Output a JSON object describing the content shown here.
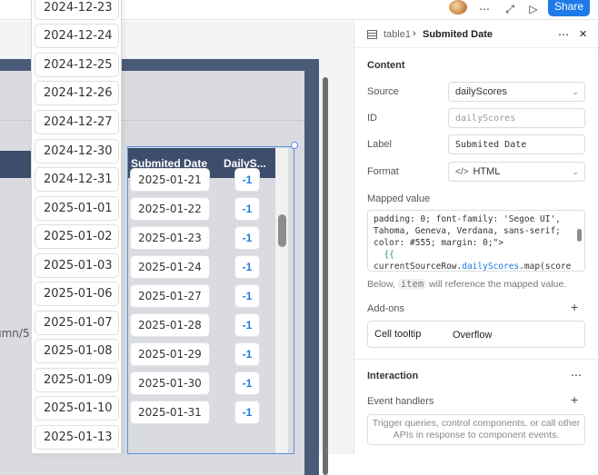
{
  "topbar": {
    "more_icon": "⋯",
    "expand_icon": "⤢",
    "play_icon": "▷",
    "share_label": "Share"
  },
  "canvas": {
    "side_text": "umn/5"
  },
  "dropdown": {
    "items": [
      "2024-12-23",
      "2024-12-24",
      "2024-12-25",
      "2024-12-26",
      "2024-12-27",
      "2024-12-30",
      "2024-12-31",
      "2025-01-01",
      "2025-01-02",
      "2025-01-03",
      "2025-01-06",
      "2025-01-07",
      "2025-01-08",
      "2025-01-09",
      "2025-01-10",
      "2025-01-13"
    ]
  },
  "table": {
    "headers": [
      "Submited Date",
      "DailyS..."
    ],
    "rows": [
      {
        "date": "2025-01-21",
        "score": "-1"
      },
      {
        "date": "2025-01-22",
        "score": "-1"
      },
      {
        "date": "2025-01-23",
        "score": "-1"
      },
      {
        "date": "2025-01-24",
        "score": "-1"
      },
      {
        "date": "2025-01-27",
        "score": "-1"
      },
      {
        "date": "2025-01-28",
        "score": "-1"
      },
      {
        "date": "2025-01-29",
        "score": "-1"
      },
      {
        "date": "2025-01-30",
        "score": "-1"
      },
      {
        "date": "2025-01-31",
        "score": "-1"
      }
    ]
  },
  "panel": {
    "breadcrumb_parent": "table1",
    "breadcrumb_sep": "›",
    "breadcrumb_current": "Submited Date",
    "more_icon": "⋯",
    "close_icon": "✕",
    "content_title": "Content",
    "source_label": "Source",
    "source_value": "dailyScores",
    "id_label": "ID",
    "id_placeholder": "dailyScores",
    "label_label": "Label",
    "label_value": "Submited Date",
    "format_label": "Format",
    "format_icon": "</>",
    "format_value": "HTML",
    "mapped_label": "Mapped value",
    "code_line1": "padding: 0; font-family: 'Segoe UI',",
    "code_line2": "Tahoma, Geneva, Verdana, sans-serif;",
    "code_line3": "color: #555; margin: 0;\">",
    "code_line4": "  {{",
    "code_line5_prefix": "currentSourceRow.",
    "code_line5_ident": "dailyScores",
    "code_line5_suffix": ".map(score",
    "hint_before": "Below,",
    "hint_code": "item",
    "hint_after": "will reference the mapped value.",
    "addons_title": "Add-ons",
    "add_icon": "+",
    "cell_tooltip_label": "Cell tooltip",
    "cell_tooltip_value": "Overflow",
    "interaction_title": "Interaction",
    "event_handlers_label": "Event handlers",
    "event_handlers_empty": "Trigger queries, control components, or call other APIs in response to component events."
  }
}
